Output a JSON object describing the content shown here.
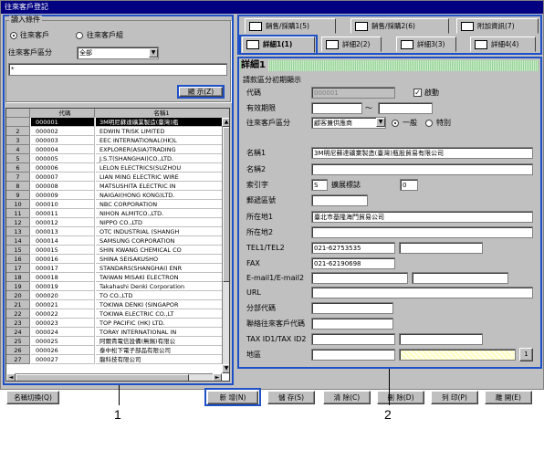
{
  "window": {
    "title": "往來客戶登記"
  },
  "left": {
    "group_label": "讀入條件",
    "radio_customer": "往來客戶",
    "radio_group": "往來客戶組",
    "category_label": "往來客戶區分",
    "category_value": "全部",
    "search_value": "*",
    "show_button": "顯 示(Z)",
    "col_code": "代碼",
    "col_name": "名稱1",
    "rows": [
      {
        "n": "",
        "code": "000001",
        "name": "3M明尼蘇達礦業製造(臺灣)瓶"
      },
      {
        "n": "2",
        "code": "000002",
        "name": "EDWIN TRISK LIMITED"
      },
      {
        "n": "3",
        "code": "000003",
        "name": "EEC INTERNATIONAL(HK)L"
      },
      {
        "n": "4",
        "code": "000004",
        "name": "EXPLORER(ASIA)TRADING"
      },
      {
        "n": "5",
        "code": "000005",
        "name": "J.S.T(SHANGHAI)CO.,LTD."
      },
      {
        "n": "6",
        "code": "000006",
        "name": "LELON ELECTRICS(SUZHOU"
      },
      {
        "n": "7",
        "code": "000007",
        "name": "LIAN MING ELECTRIC WIRE"
      },
      {
        "n": "8",
        "code": "000008",
        "name": "MATSUSHITA ELECTRIC IN"
      },
      {
        "n": "9",
        "code": "000009",
        "name": "NAIGAI(HONG KONG)LTD."
      },
      {
        "n": "10",
        "code": "000010",
        "name": "NBC CORPORATION"
      },
      {
        "n": "11",
        "code": "000011",
        "name": "NIHON ALMITCO.,LTD."
      },
      {
        "n": "12",
        "code": "000012",
        "name": "NIPPO CO.,LTD"
      },
      {
        "n": "13",
        "code": "000013",
        "name": "OTC INDUSTRIAL (SHANGH"
      },
      {
        "n": "14",
        "code": "000014",
        "name": "SAMSUNG CORPORATION"
      },
      {
        "n": "15",
        "code": "000015",
        "name": "SHIN KWANG CHEMICAL CO"
      },
      {
        "n": "16",
        "code": "000016",
        "name": "SHINA SEISAKUSHO"
      },
      {
        "n": "17",
        "code": "000017",
        "name": "STANDARS(SHANGHAI) ENR"
      },
      {
        "n": "18",
        "code": "000018",
        "name": "TAIWAN MISAKI ELECTRON"
      },
      {
        "n": "19",
        "code": "000019",
        "name": "Takahashi Denki Corporation"
      },
      {
        "n": "20",
        "code": "000020",
        "name": "TO CO.,LTD"
      },
      {
        "n": "21",
        "code": "000021",
        "name": "TOKIWA DENKI (SINGAPOR"
      },
      {
        "n": "22",
        "code": "000022",
        "name": "TOKIWA ELECTRIC CO.,LT"
      },
      {
        "n": "23",
        "code": "000023",
        "name": "TOP PACIFIC (HK) LTD."
      },
      {
        "n": "24",
        "code": "000024",
        "name": "TORAY INTERNATIONAL IN"
      },
      {
        "n": "25",
        "code": "000025",
        "name": "阿爾貴電信設備(無錫)有限公"
      },
      {
        "n": "26",
        "code": "000026",
        "name": "泰中松下電子部品有限公司"
      },
      {
        "n": "27",
        "code": "000027",
        "name": "龍科技有限公司"
      }
    ]
  },
  "tabs_top": [
    "銷售/採購1(5)",
    "銷售/採購2(6)",
    "附加資訊(7)"
  ],
  "tabs_bottom": [
    "詳細1(1)",
    "詳細2(2)",
    "詳細3(3)",
    "詳細4(4)"
  ],
  "detail": {
    "heading": "詳細1",
    "sub_heading": "請款區分初期顯示",
    "code_label": "代碼",
    "code_value": "000001",
    "active_label": "啟動",
    "valid_label": "有效期限",
    "range_sep": "～",
    "cat_label": "往來客戶區分",
    "cat_value": "顧客兼供應商",
    "radio_general": "一般",
    "radio_special": "特別",
    "name1_label": "名稱1",
    "name1_value": "3M明尼蘇達礦業製造(臺灣)瓶股貿易有限公司",
    "name2_label": "名稱2",
    "index_label": "索引字",
    "index_value": "S",
    "rank_label": "擴展標誌",
    "rank_value": "0",
    "zip_label": "郵遞區號",
    "addr1_label": "所在地1",
    "addr1_value": "臺北市基隆海門貿易公司",
    "addr2_label": "所在地2",
    "tel_label": "TEL1/TEL2",
    "tel_value": "021-62753535",
    "fax_label": "FAX",
    "fax_value": "021-62190698",
    "email_label": "E-mail1/E-mail2",
    "url_label": "URL",
    "branch_label": "分部代碼",
    "contact_label": "聯絡往來客戶代碼",
    "tax_label": "TAX ID1/TAX ID2",
    "area_label": "地區",
    "area_btn": "1"
  },
  "bottom": {
    "name_switch": "名稱切換(Q)",
    "new": "新 增(N)",
    "save": "儲 存(S)",
    "clear": "清 除(C)",
    "delete": "刪 除(D)",
    "print": "列 印(P)",
    "close": "離 開(E)"
  },
  "callouts": [
    "1",
    "2"
  ]
}
